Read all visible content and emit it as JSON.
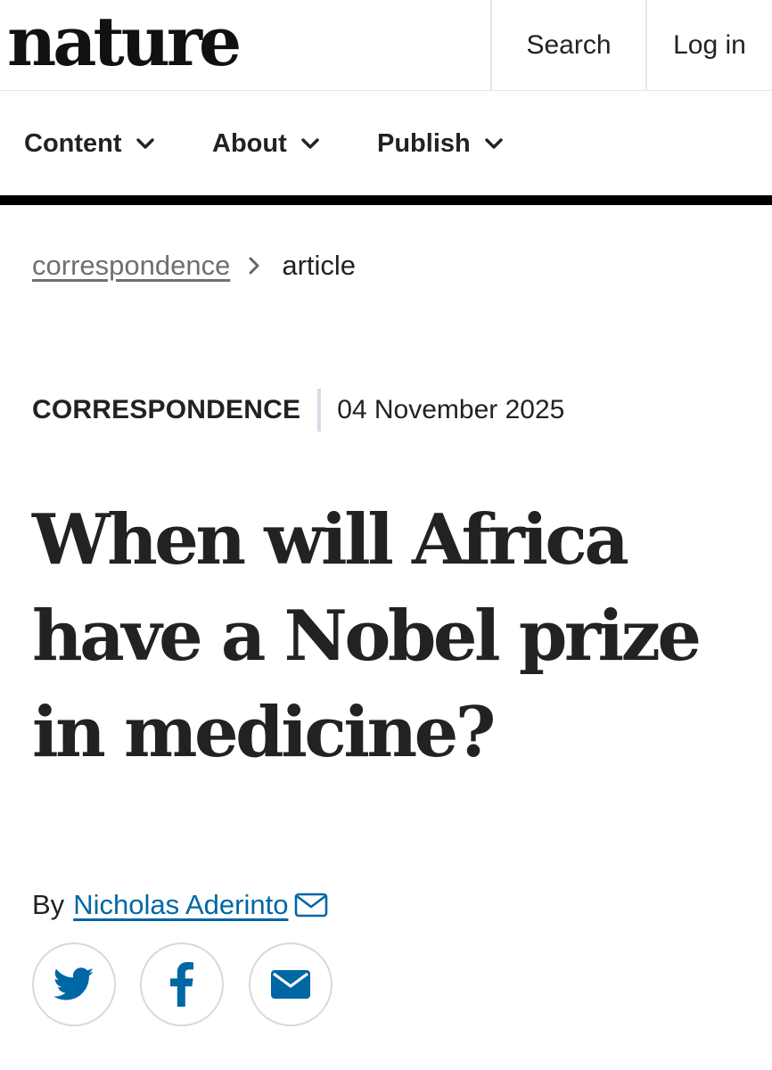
{
  "header": {
    "logo_text": "nature",
    "search_label": "Search",
    "login_label": "Log in"
  },
  "nav": {
    "items": [
      {
        "label": "Content"
      },
      {
        "label": "About"
      },
      {
        "label": "Publish"
      }
    ]
  },
  "breadcrumb": {
    "link_label": "correspondence",
    "current_label": "article"
  },
  "article": {
    "type": "CORRESPONDENCE",
    "date": "04 November 2025",
    "title_lines": [
      "When will Africa",
      "have a Nobel prize",
      "in medicine?"
    ],
    "byline_prefix": "By",
    "author": "Nicholas Aderinto"
  },
  "share": {
    "icons": [
      "twitter-icon",
      "facebook-icon",
      "email-icon"
    ]
  },
  "colors": {
    "text": "#222222",
    "link": "#0067a5",
    "muted": "#6f6f6f",
    "rule": "#000000",
    "divider": "#d5dde6"
  }
}
